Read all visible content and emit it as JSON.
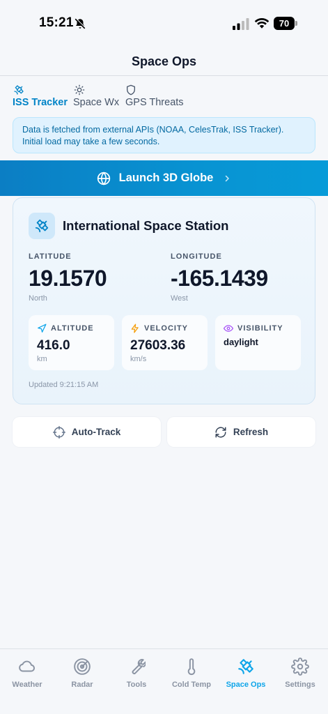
{
  "status_bar": {
    "time": "15:21",
    "battery": "70"
  },
  "header": {
    "title": "Space Ops"
  },
  "sub_tabs": [
    {
      "label": "ISS Tracker",
      "icon": "satellite-icon",
      "active": true
    },
    {
      "label": "Space Wx",
      "icon": "sun-icon",
      "active": false
    },
    {
      "label": "GPS Threats",
      "icon": "shield-icon",
      "active": false
    }
  ],
  "info_banner": {
    "text": "Data is fetched from external APIs (NOAA, CelesTrak, ISS Tracker). Initial load may take a few seconds."
  },
  "launch_button": {
    "label": "Launch 3D Globe"
  },
  "iss": {
    "title": "International Space Station",
    "latitude": {
      "label": "LATITUDE",
      "value": "19.1570",
      "direction": "North"
    },
    "longitude": {
      "label": "LONGITUDE",
      "value": "-165.1439",
      "direction": "West"
    },
    "altitude": {
      "label": "ALTITUDE",
      "value": "416.0",
      "unit": "km"
    },
    "velocity": {
      "label": "VELOCITY",
      "value": "27603.36",
      "unit": "km/s"
    },
    "visibility": {
      "label": "VISIBILITY",
      "value": "daylight"
    },
    "updated": "Updated 9:21:15 AM"
  },
  "actions": {
    "auto_track": "Auto-Track",
    "refresh": "Refresh"
  },
  "tab_bar": [
    {
      "label": "Weather",
      "icon": "cloud-icon",
      "active": false
    },
    {
      "label": "Radar",
      "icon": "radar-icon",
      "active": false
    },
    {
      "label": "Tools",
      "icon": "wrench-icon",
      "active": false
    },
    {
      "label": "Cold Temp",
      "icon": "thermometer-icon",
      "active": false
    },
    {
      "label": "Space Ops",
      "icon": "satellite-icon",
      "active": true
    },
    {
      "label": "Settings",
      "icon": "gear-icon",
      "active": false
    }
  ],
  "colors": {
    "accent": "#0ea5e9",
    "accent_dark": "#0284c7",
    "banner_bg": "#e0f2fe",
    "banner_text": "#0369a1"
  }
}
